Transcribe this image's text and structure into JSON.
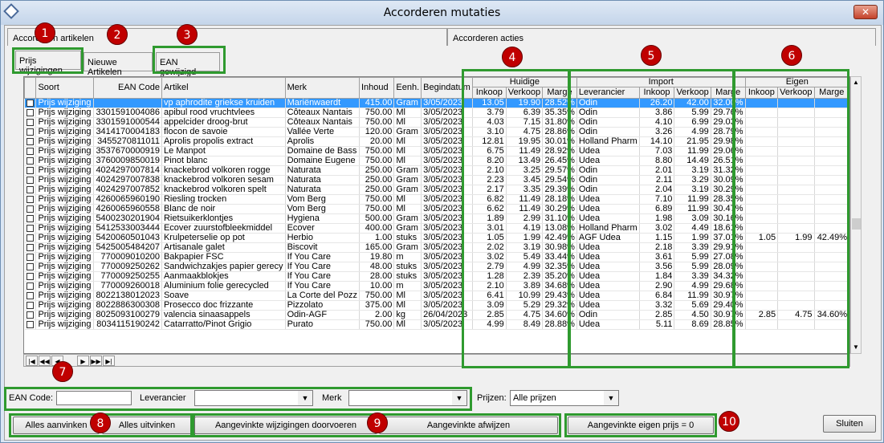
{
  "window": {
    "title": "Accorderen mutaties",
    "close": "✕"
  },
  "tabs": {
    "artikelen": "Accorderen artikelen",
    "acties": "Accorderen acties"
  },
  "subtabs": [
    "Prijs wijzigingen",
    "Nieuwe Artikelen",
    "EAN gewijzigd"
  ],
  "badges": [
    "1",
    "2",
    "3",
    "4",
    "5",
    "6",
    "7",
    "8",
    "9",
    "10"
  ],
  "headers": {
    "soort": "Soort",
    "ean": "EAN Code",
    "artikel": "Artikel",
    "merk": "Merk",
    "inhoud": "Inhoud",
    "eenh": "Eenh.",
    "begindatum": "Begindatum",
    "huidige": "Huidige",
    "import": "Import",
    "eigen": "Eigen",
    "inkoop": "Inkoop",
    "verkoop": "Verkoop",
    "marge": "Marge",
    "leverancier": "Leverancier"
  },
  "rows": [
    [
      "Prijs wijziging",
      "",
      "vp aphrodite griekse kruiden",
      "Mariënwaerdt",
      "415.00",
      "Gram",
      "3/05/2023",
      "13.05",
      "19.90",
      "28.52%",
      "Odin",
      "26.20",
      "42.00",
      "32.00%",
      "",
      "",
      ""
    ],
    [
      "Prijs wijziging",
      "3301591004086",
      "apibul rood vruchtvlees",
      "Côteaux Nantais",
      "750.00",
      "Ml",
      "3/05/2023",
      "3.79",
      "6.39",
      "35.35%",
      "Odin",
      "3.86",
      "5.99",
      "29.76%",
      "",
      "",
      ""
    ],
    [
      "Prijs wijziging",
      "3301591000544",
      "appelcider droog-brut",
      "Côteaux Nantais",
      "750.00",
      "Ml",
      "3/05/2023",
      "4.03",
      "7.15",
      "31.80%",
      "Odin",
      "4.10",
      "6.99",
      "29.03%",
      "",
      "",
      ""
    ],
    [
      "Prijs wijziging",
      "3414170004183",
      "flocon de savoie",
      "Vallée Verte",
      "120.00",
      "Gram",
      "3/05/2023",
      "3.10",
      "4.75",
      "28.86%",
      "Odin",
      "3.26",
      "4.99",
      "28.79%",
      "",
      "",
      ""
    ],
    [
      "Prijs wijziging",
      "3455270811011",
      "Aprolis propolis extract",
      "Aprolis",
      "20.00",
      "Ml",
      "3/05/2023",
      "12.81",
      "19.95",
      "30.01%",
      "Holland Pharm",
      "14.10",
      "21.95",
      "29.98%",
      "",
      "",
      ""
    ],
    [
      "Prijs wijziging",
      "3537670000919",
      "Le Manpot",
      "Domaine de Bass",
      "750.00",
      "Ml",
      "3/05/2023",
      "6.75",
      "11.49",
      "28.92%",
      "Udea",
      "7.03",
      "11.99",
      "29.06%",
      "",
      "",
      ""
    ],
    [
      "Prijs wijziging",
      "3760009850019",
      "Pinot blanc",
      "Domaine Eugene",
      "750.00",
      "Ml",
      "3/05/2023",
      "8.20",
      "13.49",
      "26.45%",
      "Udea",
      "8.80",
      "14.49",
      "26.51%",
      "",
      "",
      ""
    ],
    [
      "Prijs wijziging",
      "4024297007814",
      "knackebrod volkoren rogge",
      "Naturata",
      "250.00",
      "Gram",
      "3/05/2023",
      "2.10",
      "3.25",
      "29.57%",
      "Odin",
      "2.01",
      "3.19",
      "31.32%",
      "",
      "",
      ""
    ],
    [
      "Prijs wijziging",
      "4024297007838",
      "knackebrod volkoren sesam",
      "Naturata",
      "250.00",
      "Gram",
      "3/05/2023",
      "2.23",
      "3.45",
      "29.54%",
      "Odin",
      "2.11",
      "3.29",
      "30.09%",
      "",
      "",
      ""
    ],
    [
      "Prijs wijziging",
      "4024297007852",
      "knackebrod volkoren spelt",
      "Naturata",
      "250.00",
      "Gram",
      "3/05/2023",
      "2.17",
      "3.35",
      "29.39%",
      "Odin",
      "2.04",
      "3.19",
      "30.29%",
      "",
      "",
      ""
    ],
    [
      "Prijs wijziging",
      "4260065960190",
      "Riesling trocken",
      "Vom Berg",
      "750.00",
      "Ml",
      "3/05/2023",
      "6.82",
      "11.49",
      "28.18%",
      "Udea",
      "7.10",
      "11.99",
      "28.35%",
      "",
      "",
      ""
    ],
    [
      "Prijs wijziging",
      "4260065960558",
      "Blanc de noir",
      "Vom Berg",
      "750.00",
      "Ml",
      "3/05/2023",
      "6.62",
      "11.49",
      "30.29%",
      "Udea",
      "6.89",
      "11.99",
      "30.47%",
      "",
      "",
      ""
    ],
    [
      "Prijs wijziging",
      "5400230201904",
      "Rietsuikerklontjes",
      "Hygiena",
      "500.00",
      "Gram",
      "3/05/2023",
      "1.89",
      "2.99",
      "31.10%",
      "Udea",
      "1.98",
      "3.09",
      "30.16%",
      "",
      "",
      ""
    ],
    [
      "Prijs wijziging",
      "5412533003444",
      "Ecover zuurstofbleekmiddel",
      "Ecover",
      "400.00",
      "Gram",
      "3/05/2023",
      "3.01",
      "4.19",
      "13.08%",
      "Holland Pharm",
      "3.02",
      "4.49",
      "18.61%",
      "",
      "",
      ""
    ],
    [
      "Prijs wijziging",
      "5420060501043",
      "Krulpeterselie op pot",
      "Herbio",
      "1.00",
      "stuks",
      "3/05/2023",
      "1.05",
      "1.99",
      "42.49%",
      "AGF Udea",
      "1.15",
      "1.99",
      "37.01%",
      "1.05",
      "1.99",
      "42.49%"
    ],
    [
      "Prijs wijziging",
      "5425005484207",
      "Artisanale galet",
      "Biscovit",
      "165.00",
      "Gram",
      "3/05/2023",
      "2.02",
      "3.19",
      "30.98%",
      "Udea",
      "2.18",
      "3.39",
      "29.91%",
      "",
      "",
      ""
    ],
    [
      "Prijs wijziging",
      "770009010200",
      "Bakpapier FSC",
      "If You Care",
      "19.80",
      "m",
      "3/05/2023",
      "3.02",
      "5.49",
      "33.44%",
      "Udea",
      "3.61",
      "5.99",
      "27.08%",
      "",
      "",
      ""
    ],
    [
      "Prijs wijziging",
      "770009250262",
      "Sandwichzakjes papier gerecy",
      "If You Care",
      "48.00",
      "stuks",
      "3/05/2023",
      "2.79",
      "4.99",
      "32.35%",
      "Udea",
      "3.56",
      "5.99",
      "28.09%",
      "",
      "",
      ""
    ],
    [
      "Prijs wijziging",
      "770009250255",
      "Aanmaakblokjes",
      "If You Care",
      "28.00",
      "stuks",
      "3/05/2023",
      "1.28",
      "2.39",
      "35.20%",
      "Udea",
      "1.84",
      "3.39",
      "34.32%",
      "",
      "",
      ""
    ],
    [
      "Prijs wijziging",
      "770009260018",
      "Aluminium folie gerecycled",
      "If You Care",
      "10.00",
      "m",
      "3/05/2023",
      "2.10",
      "3.89",
      "34.68%",
      "Udea",
      "2.90",
      "4.99",
      "29.68%",
      "",
      "",
      ""
    ],
    [
      "Prijs wijziging",
      "8022138012023",
      "Soave",
      "La Corte del Pozz",
      "750.00",
      "Ml",
      "3/05/2023",
      "6.41",
      "10.99",
      "29.43%",
      "Udea",
      "6.84",
      "11.99",
      "30.97%",
      "",
      "",
      ""
    ],
    [
      "Prijs wijziging",
      "8022886300308",
      "Prosecco doc frizzante",
      "Pizzolato",
      "375.00",
      "Ml",
      "3/05/2023",
      "3.09",
      "5.29",
      "29.32%",
      "Udea",
      "3.32",
      "5.69",
      "29.40%",
      "",
      "",
      ""
    ],
    [
      "Prijs wijziging",
      "8025093100279",
      "valencia sinaasappels",
      "Odin-AGF",
      "2.00",
      "kg",
      "26/04/2023",
      "2.85",
      "4.75",
      "34.60%",
      "Odin",
      "2.85",
      "4.50",
      "30.97%",
      "2.85",
      "4.75",
      "34.60%"
    ],
    [
      "Prijs wijziging",
      "8034115190242",
      "Catarratto/Pinot Grigio",
      "Purato",
      "750.00",
      "Ml",
      "3/05/2023",
      "4.99",
      "8.49",
      "28.88%",
      "Udea",
      "5.11",
      "8.69",
      "28.85%",
      "",
      "",
      ""
    ]
  ],
  "navigator": [
    "|◀",
    "◀◀",
    "◀",
    "▶",
    "▶▶",
    "▶|"
  ],
  "filters": {
    "ean_label": "EAN Code:",
    "ean_value": "",
    "leverancier_label": "Leverancier",
    "leverancier_value": "",
    "merk_label": "Merk",
    "merk_value": "",
    "prijzen_label": "Prijzen:",
    "prijzen_value": "Alle prijzen"
  },
  "buttons": {
    "alles_aanvinken": "Alles aanvinken",
    "alles_uitvinken": "Alles uitvinken",
    "doorvoeren": "Aangevinkte wijzigingen doorvoeren",
    "afwijzen": "Aangevinkte afwijzen",
    "eigen_prijs": "Aangevinkte eigen prijs = 0",
    "sluiten": "Sluiten"
  }
}
